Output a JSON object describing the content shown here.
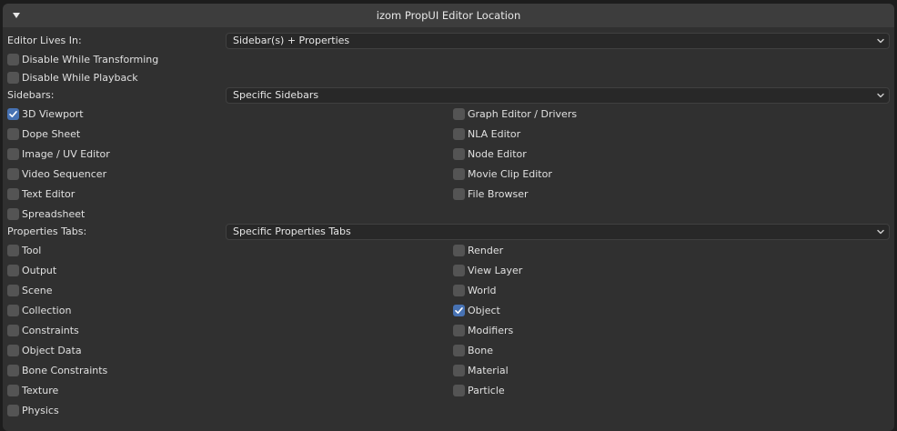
{
  "panel": {
    "title": "izom PropUI Editor Location"
  },
  "editor_lives_in": {
    "label": "Editor Lives In:",
    "value": "Sidebar(s) + Properties"
  },
  "options": {
    "disable_transforming": {
      "label": "Disable While Transforming",
      "checked": false
    },
    "disable_playback": {
      "label": "Disable While Playback",
      "checked": false
    }
  },
  "sidebars": {
    "label": "Sidebars:",
    "value": "Specific Sidebars",
    "items": [
      {
        "label": "3D Viewport",
        "checked": true
      },
      {
        "label": "Graph Editor / Drivers",
        "checked": false
      },
      {
        "label": "Dope Sheet",
        "checked": false
      },
      {
        "label": "NLA Editor",
        "checked": false
      },
      {
        "label": "Image / UV Editor",
        "checked": false
      },
      {
        "label": "Node Editor",
        "checked": false
      },
      {
        "label": "Video Sequencer",
        "checked": false
      },
      {
        "label": "Movie Clip Editor",
        "checked": false
      },
      {
        "label": "Text Editor",
        "checked": false
      },
      {
        "label": "File Browser",
        "checked": false
      },
      {
        "label": "Spreadsheet",
        "checked": false
      }
    ]
  },
  "properties_tabs": {
    "label": "Properties Tabs:",
    "value": "Specific Properties Tabs",
    "items": [
      {
        "label": "Tool",
        "checked": false
      },
      {
        "label": "Render",
        "checked": false
      },
      {
        "label": "Output",
        "checked": false
      },
      {
        "label": "View Layer",
        "checked": false
      },
      {
        "label": "Scene",
        "checked": false
      },
      {
        "label": "World",
        "checked": false
      },
      {
        "label": "Collection",
        "checked": false
      },
      {
        "label": "Object",
        "checked": true
      },
      {
        "label": "Constraints",
        "checked": false
      },
      {
        "label": "Modifiers",
        "checked": false
      },
      {
        "label": "Object Data",
        "checked": false
      },
      {
        "label": "Bone",
        "checked": false
      },
      {
        "label": "Bone Constraints",
        "checked": false
      },
      {
        "label": "Material",
        "checked": false
      },
      {
        "label": "Texture",
        "checked": false
      },
      {
        "label": "Particle",
        "checked": false
      },
      {
        "label": "Physics",
        "checked": false
      }
    ]
  },
  "colors": {
    "background": "#1d1d1d",
    "panel": "#303030",
    "header": "#3d3d3d",
    "accent_checked": "#4772b3",
    "checkbox_unchecked": "#545454"
  }
}
